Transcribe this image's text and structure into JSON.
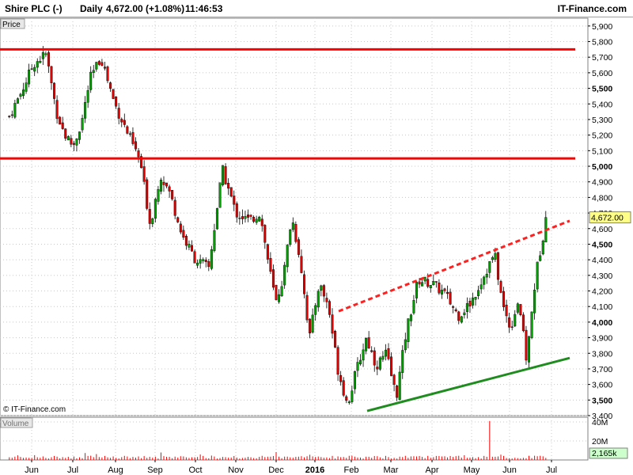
{
  "header": {
    "instrument": "Shire PLC (-)",
    "period": "Daily",
    "quote": "4,672.00 (+1.08%)",
    "time": "11:46:53",
    "brand": "IT-Finance.com"
  },
  "panes": {
    "price_label": "Price",
    "volume_label": "Volume",
    "watermark": "© IT-Finance.com",
    "last_price_tag": "4,672.00",
    "last_volume_tag": "2,165k"
  },
  "colors": {
    "up": "#00a000",
    "down": "#e00000",
    "wick": "#000000",
    "resistance": "#ff0000",
    "channel_support": "#1e8c1e",
    "channel_resistance": "#ff2020",
    "volume": "#ff0000",
    "grid": "#c8c8c8",
    "price_tag_bg": "#ffff88",
    "volume_tag_bg": "#ccffcc"
  },
  "chart_data": {
    "type": "candlestick",
    "x_tick_labels": [
      "Jun",
      "Jul",
      "Aug",
      "Sep",
      "Oct",
      "Nov",
      "Dec",
      "2016",
      "Feb",
      "Mar",
      "Apr",
      "May",
      "Jun",
      "Jul"
    ],
    "price_axis": {
      "ylim": [
        3400,
        5950
      ],
      "ticks": [
        3400,
        3500,
        3600,
        3700,
        3800,
        3900,
        4000,
        4100,
        4200,
        4300,
        4400,
        4500,
        4600,
        4700,
        4800,
        4900,
        5000,
        5100,
        5200,
        5300,
        5400,
        5500,
        5600,
        5700,
        5800,
        5900
      ],
      "tick_labels": [
        "3,400",
        "3,500",
        "3,600",
        "3,700",
        "3,800",
        "3,900",
        "4,000",
        "4,100",
        "4,200",
        "4,300",
        "4,400",
        "4,500",
        "4,600",
        "4,700",
        "4,800",
        "4,900",
        "5,000",
        "5,100",
        "5,200",
        "5,300",
        "5,400",
        "5,500",
        "5,600",
        "5,700",
        "5,800",
        "5,900"
      ]
    },
    "volume_axis": {
      "ylim": [
        0,
        45
      ],
      "ticks": [
        20,
        40
      ],
      "tick_labels": [
        "20M",
        "40M"
      ]
    },
    "last_price": 4672,
    "last_volume_k": 2165,
    "price_path": [
      [
        "Jun",
        5320
      ],
      [
        "Jun",
        5480
      ],
      [
        "Jun",
        5660
      ],
      [
        "Jun",
        5720
      ],
      [
        "Jul",
        5350
      ],
      [
        "Jul",
        5200
      ],
      [
        "Jul",
        5130
      ],
      [
        "Jul",
        5280
      ],
      [
        "Jul",
        5560
      ],
      [
        "Aug",
        5700
      ],
      [
        "Aug",
        5400
      ],
      [
        "Aug",
        5200
      ],
      [
        "Sep",
        5030
      ],
      [
        "Sep",
        4620
      ],
      [
        "Sep",
        4950
      ],
      [
        "Sep",
        4820
      ],
      [
        "Oct",
        4560
      ],
      [
        "Oct",
        4400
      ],
      [
        "Oct",
        4350
      ],
      [
        "Nov",
        4980
      ],
      [
        "Nov",
        4700
      ],
      [
        "Nov",
        4650
      ],
      [
        "Dec",
        4700
      ],
      [
        "Dec",
        4400
      ],
      [
        "Dec",
        4120
      ],
      [
        "Dec",
        4300
      ],
      [
        "Dec",
        4680
      ],
      [
        "2016",
        4400
      ],
      [
        "2016",
        3900
      ],
      [
        "2016",
        4250
      ],
      [
        "2016",
        4100
      ],
      [
        "Feb",
        3700
      ],
      [
        "Feb",
        3470
      ],
      [
        "Feb",
        3700
      ],
      [
        "Feb",
        3900
      ],
      [
        "Mar",
        3720
      ],
      [
        "Mar",
        3800
      ],
      [
        "Mar",
        3520
      ],
      [
        "Mar",
        3950
      ],
      [
        "Apr",
        4270
      ],
      [
        "Apr",
        4250
      ],
      [
        "Apr",
        4180
      ],
      [
        "May",
        4040
      ],
      [
        "May",
        4130
      ],
      [
        "May",
        4300
      ],
      [
        "Jun",
        4440
      ],
      [
        "Jun",
        4110
      ],
      [
        "Jun",
        3960
      ],
      [
        "Jun",
        4150
      ],
      [
        "Jun",
        3750
      ],
      [
        "Jul",
        4300
      ],
      [
        "Jul",
        4672
      ]
    ],
    "trend_lines": [
      {
        "kind": "resistance",
        "style": "solid",
        "points": [
          [
            "Jun",
            5750
          ],
          [
            "Jul",
            5750
          ]
        ]
      },
      {
        "kind": "support",
        "style": "solid",
        "points": [
          [
            "Jun",
            5050
          ],
          [
            "Jul",
            5050
          ]
        ]
      },
      {
        "kind": "channel-support",
        "style": "solid",
        "points": [
          [
            "Feb",
            3430
          ],
          [
            "Jul",
            3770
          ]
        ]
      },
      {
        "kind": "channel-resistance",
        "style": "dashed",
        "points": [
          [
            "2016",
            4070
          ],
          [
            "Jul",
            4650
          ]
        ]
      }
    ]
  }
}
